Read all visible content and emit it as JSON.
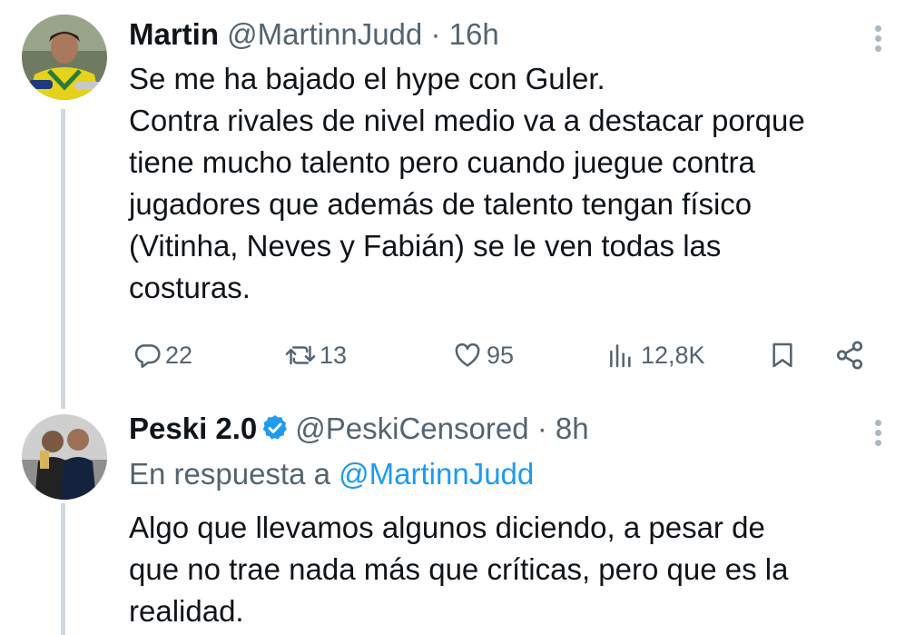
{
  "tweets": [
    {
      "name": "Martin",
      "handle": "@MartinnJudd",
      "separator": "·",
      "time": "16h",
      "lines": [
        "Se me ha bajado el hype con Guler.",
        "Contra rivales de nivel medio va a destacar porque",
        "tiene mucho talento pero cuando juegue contra",
        "jugadores que además de talento tengan físico",
        "(Vitinha, Neves y Fabián) se le ven todas las",
        "costuras."
      ],
      "actions": {
        "replies": "22",
        "retweets": "13",
        "likes": "95",
        "views": "12,8K"
      }
    },
    {
      "name": "Peski 2.0",
      "verified": true,
      "handle": "@PeskiCensored",
      "separator": "·",
      "time": "8h",
      "reply_to_label": "En respuesta a",
      "reply_to_handle": "@MartinnJudd",
      "lines": [
        "Algo que llevamos algunos diciendo, a pesar de",
        "que no trae nada más que críticas, pero que es la",
        "realidad."
      ]
    }
  ],
  "colors": {
    "text": "#0f1419",
    "secondary": "#536471",
    "link": "#1d9bf0",
    "thread_line": "#cfd9de"
  },
  "icons": [
    "reply-icon",
    "retweet-icon",
    "like-icon",
    "views-icon",
    "bookmark-icon",
    "share-icon",
    "more-icon",
    "verified-badge-icon"
  ]
}
